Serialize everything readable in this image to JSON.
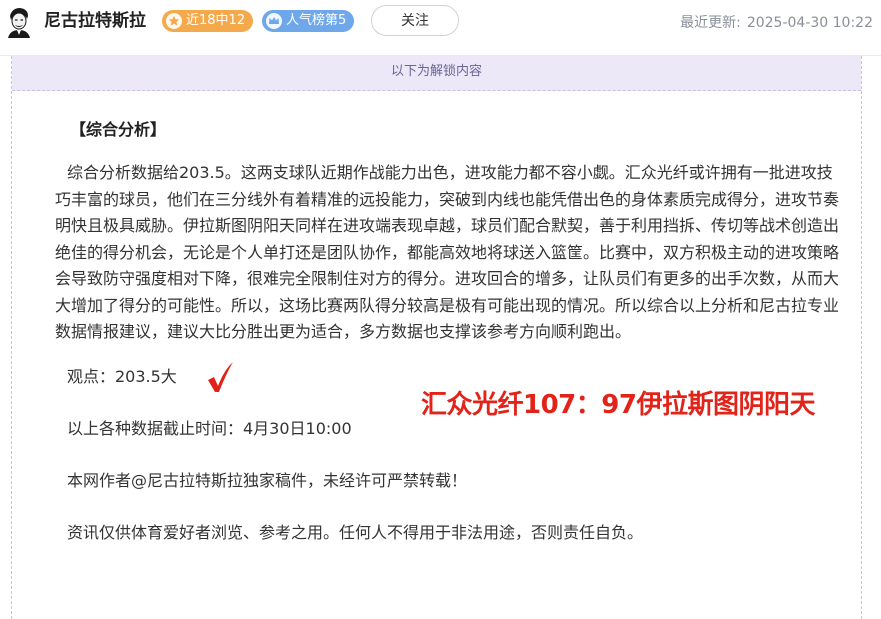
{
  "header": {
    "author_name": "尼古拉特斯拉",
    "badges": {
      "streak": "近18中12",
      "rank": "人气榜第5"
    },
    "follow_label": "关注",
    "update_label": "最近更新:",
    "update_time": "2025-04-30 10:22"
  },
  "article": {
    "unlock_banner": "以下为解锁内容",
    "section_title": "【综合分析】",
    "analysis": "综合分析数据给203.5。这两支球队近期作战能力出色，进攻能力都不容小觑。汇众光纤或许拥有一批进攻技巧丰富的球员，他们在三分线外有着精准的远投能力，突破到内线也能凭借出色的身体素质完成得分，进攻节奏明快且极具威胁。伊拉斯图阴阳天同样在进攻端表现卓越，球员们配合默契，善于利用挡拆、传切等战术创造出绝佳的得分机会，无论是个人单打还是团队协作，都能高效地将球送入篮筐。比赛中，双方积极主动的进攻策略会导致防守强度相对下降，很难完全限制住对方的得分。进攻回合的增多，让队员们有更多的出手次数，从而大大增加了得分的可能性。所以，这场比赛两队得分较高是极有可能出现的情况。所以综合以上分析和尼古拉专业数据情报建议，建议大比分胜出更为适合，多方数据也支撑该参考方向顺利跑出。",
    "view_point": "观点：203.5大",
    "score_callout": "汇众光纤107：97伊拉斯图阴阳天",
    "data_cutoff": "以上各种数据截止时间：4月30日10:00",
    "copyright": "本网作者@尼古拉特斯拉独家稿件，未经许可严禁转载！",
    "disclaimer": "资讯仅供体育爱好者浏览、参考之用。任何人不得用于非法用途，否则责任自负。"
  },
  "colors": {
    "streak_badge": "#f4a94b",
    "rank_badge": "#6fa8ea",
    "banner_bg": "#ece8f8",
    "callout_red": "#e2231a"
  },
  "icons": {
    "avatar": "tesla-portrait-avatar",
    "streak": "star-icon",
    "rank": "crown-icon",
    "check": "red-check-icon"
  }
}
